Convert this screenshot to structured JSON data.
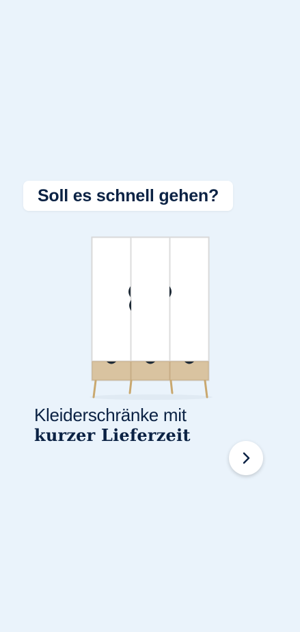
{
  "promo": {
    "badge_label": "Soll es schnell gehen?",
    "title_line1": "Kleiderschränke mit",
    "title_line2": "kurzer Lieferzeit",
    "product_image": "wardrobe-image",
    "next_icon": "chevron-right-icon"
  },
  "colors": {
    "background": "#eaf3fb",
    "text": "#0b2244",
    "card": "#ffffff",
    "wood": "#d9c3a0"
  }
}
